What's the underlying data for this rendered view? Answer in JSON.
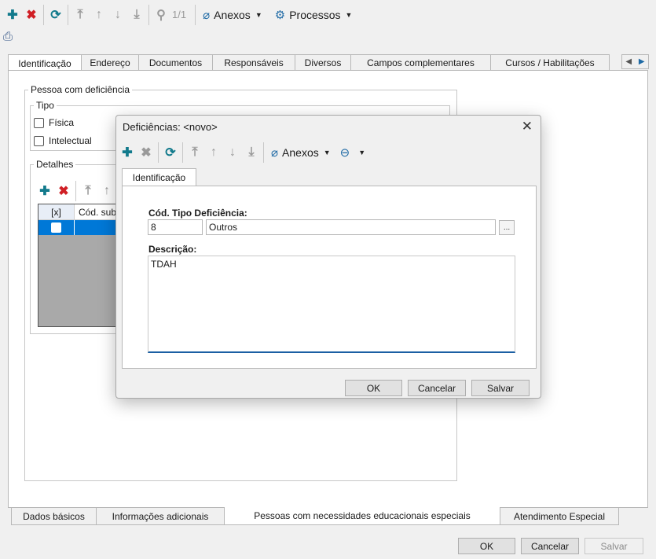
{
  "toolbar": {
    "add_icon": "plus-icon",
    "delete_icon": "x-icon",
    "refresh_icon": "refresh-icon",
    "page_counter": "1/1",
    "attachments_label": "Anexos",
    "processes_label": "Processos"
  },
  "tabs": [
    "Identificação",
    "Endereço",
    "Documentos",
    "Responsáveis",
    "Diversos",
    "Campos complementares",
    "Cursos / Habilitações"
  ],
  "active_tab": "Identificação",
  "main": {
    "deficiency_group": "Pessoa com deficiência",
    "type_group": "Tipo",
    "type_options": [
      "Física",
      "Intelectual"
    ],
    "details_group": "Detalhes",
    "grid_headers": [
      "[x]",
      "Cód. subd"
    ]
  },
  "bottom_tabs": [
    "Dados básicos",
    "Informações adicionais",
    "Pessoas com necessidades educacionais especiais",
    "Atendimento Especial"
  ],
  "active_bottom_tab": "Pessoas com necessidades educacionais especiais",
  "footer": {
    "ok": "OK",
    "cancel": "Cancelar",
    "save": "Salvar"
  },
  "dialog": {
    "title": "Deficiências: <novo>",
    "attachments_label": "Anexos",
    "tab": "Identificação",
    "code_label": "Cód. Tipo Deficiência:",
    "code_value": "8",
    "code_description": "Outros",
    "lookup_label": "...",
    "description_label": "Descrição:",
    "description_value": "TDAH",
    "ok": "OK",
    "cancel": "Cancelar",
    "save": "Salvar"
  },
  "colors": {
    "accent": "#0078d7",
    "teal_icon": "#127a8c",
    "red_icon": "#d01f25",
    "grid_grey": "#a9a9a9"
  }
}
